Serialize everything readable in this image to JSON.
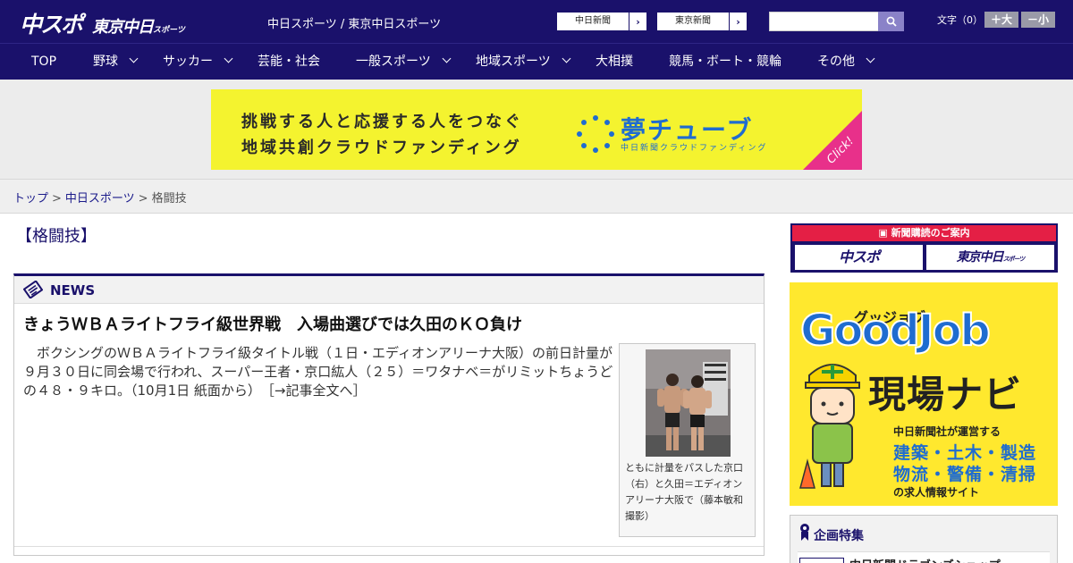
{
  "header": {
    "logo_main": "中スポ",
    "logo_tokyo": "東京中日",
    "logo_sub": "スポーツ",
    "site_names": "中日スポーツ / 東京中日スポーツ",
    "btn_chunichi": "中日新聞",
    "btn_tokyo": "東京新聞",
    "search_placeholder": "",
    "fontsize_label": "文字（0）",
    "fs_plus": "＋大",
    "fs_minus": "－小"
  },
  "nav": {
    "items": [
      {
        "label": "TOP"
      },
      {
        "label": "野球"
      },
      {
        "label": "サッカー"
      },
      {
        "label": "芸能・社会"
      },
      {
        "label": "一般スポーツ"
      },
      {
        "label": "地域スポーツ"
      },
      {
        "label": "大相撲"
      },
      {
        "label": "競馬・ボート・競輪"
      },
      {
        "label": "その他"
      }
    ]
  },
  "banner": {
    "line1": "挑戦する人と応援する人をつなぐ",
    "line2": "地域共創クラウドファンディング",
    "logo": "夢チューブ",
    "logo_sub": "中日新聞クラウドファンディング",
    "click": "Click!"
  },
  "breadcrumb": {
    "items": [
      "トップ",
      "中日スポーツ",
      "格闘技"
    ],
    "separator": ">"
  },
  "page": {
    "title": "【格闘技】"
  },
  "news": {
    "label": "NEWS",
    "article": {
      "title": "きょうＷＢＡライトフライ級世界戦　入場曲選びでは久田のＫＯ負け",
      "body": "ボクシングのＷＢＡライトフライ級タイトル戦（１日・エディオンアリーナ大阪）の前日計量が９月３０日に同会場で行われ、スーパー王者・京口紘人（２５）＝ワタナベ＝がリミットちょうどの４８・９キロ。（10月1日 紙面から）",
      "more": "［→記事全文へ］",
      "caption": "ともに計量をパスした京口（右）と久田＝エディオンアリーナ大阪で（藤本敏和撮影）"
    }
  },
  "sidebar": {
    "subscribe_head": "新聞購読のご案内",
    "subscribe_logo1": "中スポ",
    "subscribe_logo2": "東京中日",
    "subscribe_logo2_sub": "スポーツ",
    "job": {
      "ruby": "グッジョブ",
      "title": "GoodJob",
      "big": "現場ナビ",
      "l1": "中日新聞社が運営する",
      "l2": "建築・土木・製造",
      "l3": "物流・警備・清掃",
      "l4": "の求人情報サイト"
    },
    "kikaku_head": "企画特集",
    "kikaku_item": "中日新聞ドラゴンズショップ"
  },
  "colors": {
    "brand_navy": "#1a116b",
    "accent_red": "#e41f45",
    "banner_yellow": "#f4f32f",
    "job_yellow": "#ffe82e",
    "link_blue": "#1a1a8a"
  }
}
